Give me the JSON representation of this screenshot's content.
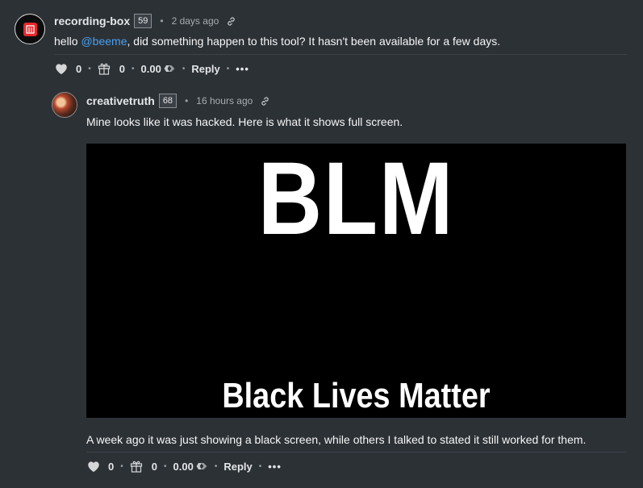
{
  "comments": [
    {
      "author": "recording-box",
      "reputation": "59",
      "time": "2 days ago",
      "body_prefix": "hello ",
      "mention": "@beeme",
      "body_suffix": ", did something happen to this tool? It hasn't been available for a few days.",
      "votes": "0",
      "gifts": "0",
      "payout": "0.00",
      "reply_label": "Reply",
      "more_label": "•••"
    },
    {
      "author": "creativetruth",
      "reputation": "68",
      "time": "16 hours ago",
      "body_1": "Mine looks like it was hacked. Here is what it shows full screen.",
      "image": {
        "headline": "BLM",
        "caption": "Black Lives Matter"
      },
      "body_2": "A week ago it was just showing a black screen, while others I talked to stated it still worked for them.",
      "votes": "0",
      "gifts": "0",
      "payout": "0.00",
      "reply_label": "Reply",
      "more_label": "•••"
    }
  ],
  "colors": {
    "background": "#2c3136",
    "mention": "#4aa0f0",
    "avatar_logo": "#e8252a"
  },
  "icons": [
    "heart-icon",
    "gift-icon",
    "hive-icon",
    "link-icon"
  ]
}
